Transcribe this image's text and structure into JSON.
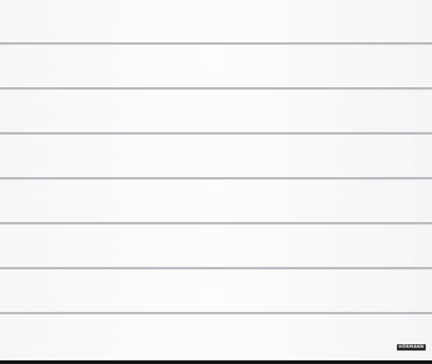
{
  "image": {
    "subject": "garage-door",
    "brand_logo": "HÖRMANN",
    "colors": {
      "door": "#fbfbfc",
      "groove": "#b0b3b7",
      "seal": "#111111",
      "logo_plate": "#2a2a2a"
    }
  }
}
